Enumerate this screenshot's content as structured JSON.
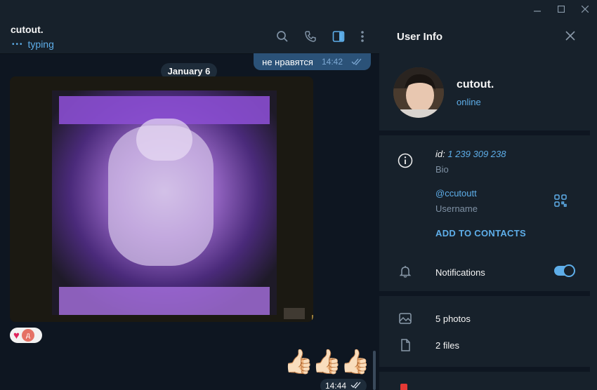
{
  "chat": {
    "title": "cutout.",
    "status": "typing",
    "prev_message": {
      "text": "не нравятся",
      "time": "14:42"
    },
    "date_label": "January 6",
    "reaction_avatar_letter": "д",
    "sticker": "👍🏻👍🏻👍🏻",
    "last_time": "14:44"
  },
  "header_icons": [
    "search-icon",
    "phone-icon",
    "sidebar-toggle-icon",
    "more-icon"
  ],
  "panel": {
    "title": "User Info",
    "name": "cutout.",
    "online": "online",
    "id_label": "id:",
    "id_value": "1 239 309 238",
    "bio_label": "Bio",
    "username": "@ccutoutt",
    "username_label": "Username",
    "add_contacts": "ADD TO CONTACTS",
    "notifications": "Notifications",
    "notifications_on": true,
    "photos": "5 photos",
    "files": "2 files"
  },
  "colors": {
    "accent": "#5eaee9",
    "bubble_out": "#2b5278",
    "bg": "#0e1621",
    "panel": "#17212b"
  }
}
